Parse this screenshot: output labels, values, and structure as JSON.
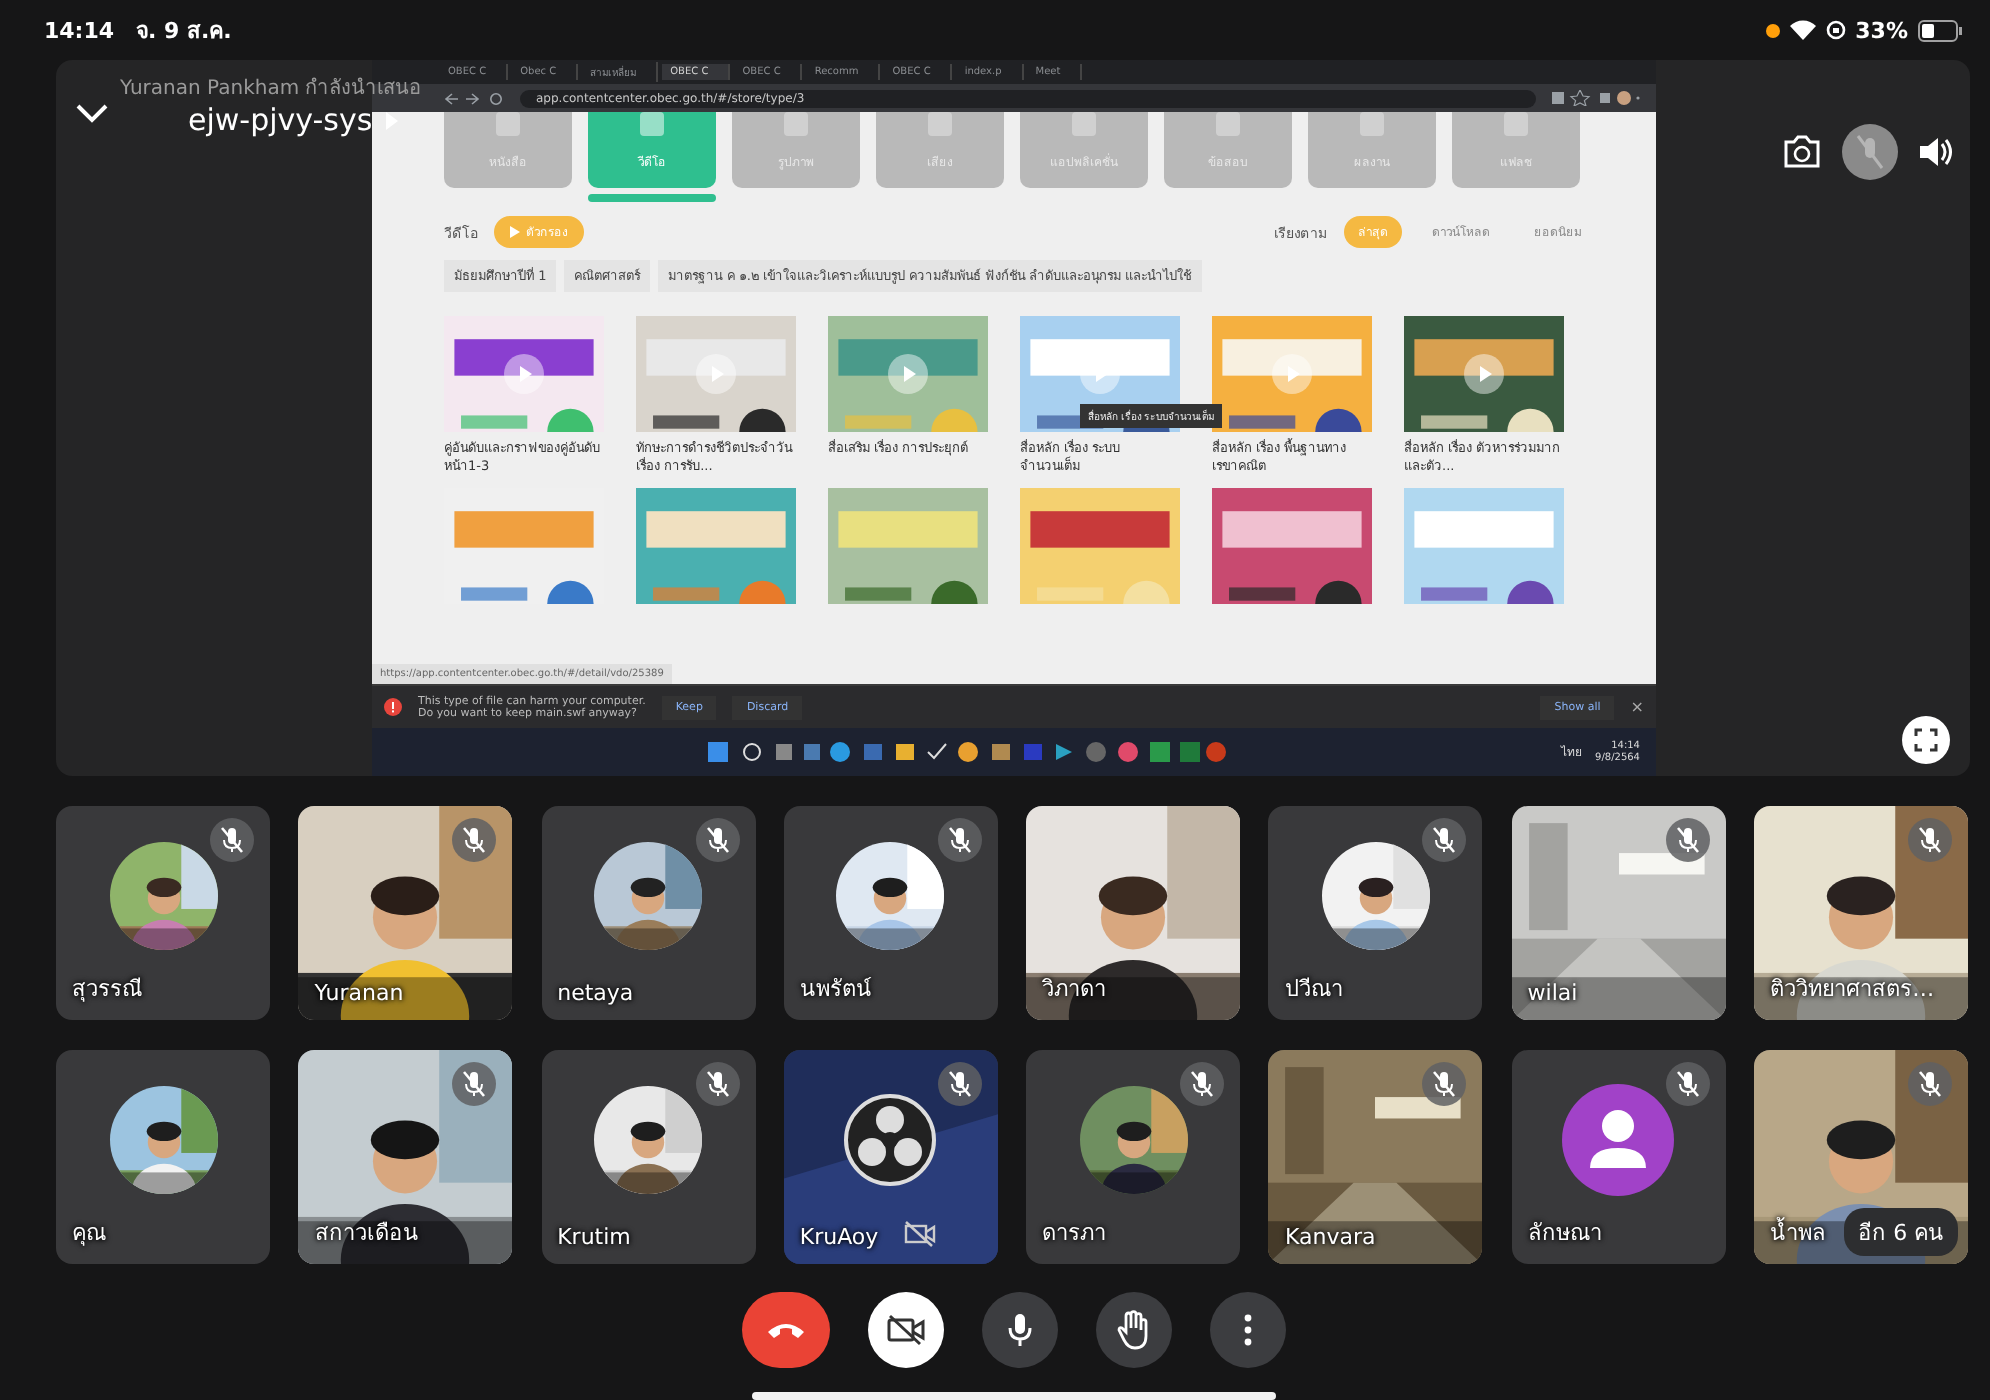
{
  "status_bar": {
    "time": "14:14",
    "date": "จ. 9 ส.ค.",
    "battery": "33%"
  },
  "presentation": {
    "presenter": "Yuranan Pankham กำลังนำเสนอ",
    "meeting_code": "ejw-pjvy-sys"
  },
  "shared_screen": {
    "browser_tabs": [
      {
        "title": "OBEC C",
        "selected": false
      },
      {
        "title": "Obec C",
        "selected": false
      },
      {
        "title": "สามเหลี่ยม",
        "selected": false
      },
      {
        "title": "OBEC C",
        "selected": true
      },
      {
        "title": "OBEC C",
        "selected": false
      },
      {
        "title": "Recomm",
        "selected": false
      },
      {
        "title": "OBEC C",
        "selected": false
      },
      {
        "title": "index.p",
        "selected": false
      },
      {
        "title": "Meet",
        "selected": false
      }
    ],
    "url": "app.contentcenter.obec.go.th/#/store/type/3",
    "categories": [
      {
        "label": "หนังสือ",
        "selected": false
      },
      {
        "label": "วีดีโอ",
        "selected": true
      },
      {
        "label": "รูปภาพ",
        "selected": false
      },
      {
        "label": "เสียง",
        "selected": false
      },
      {
        "label": "แอปพลิเคชั่น",
        "selected": false
      },
      {
        "label": "ข้อสอบ",
        "selected": false
      },
      {
        "label": "ผลงาน",
        "selected": false
      },
      {
        "label": "แฟลช",
        "selected": false
      }
    ],
    "section_title": "วีดีโอ",
    "filter_button": "ตัวกรอง",
    "sort_label": "เรียงตาม",
    "sort_options": [
      {
        "label": "ล่าสุด",
        "selected": true
      },
      {
        "label": "ดาวน์โหลด",
        "selected": false
      },
      {
        "label": "ยอดนิยม",
        "selected": false
      }
    ],
    "breadcrumb": [
      "มัธยมศึกษาปีที่ 1",
      "คณิตศาสตร์",
      "มาตรฐาน ค ๑.๒ เข้าใจและวิเคราะห์แบบรูป ความสัมพันธ์ ฟังก์ชัน ลำดับและอนุกรม และนำไปใช้"
    ],
    "videos": [
      {
        "title": "คู่อันดับและกราฟของคู่อันดับ หน้า1-3"
      },
      {
        "title": "ทักษะการดำรงชีวิตประจำวัน เรื่อง การรับ..."
      },
      {
        "title": "สื่อเสริม เรื่อง การประยุกต์"
      },
      {
        "title": "สื่อหลัก เรื่อง ระบบจำนวนเต็ม",
        "tooltip": "สื่อหลัก เรื่อง ระบบจำนวนเต็ม"
      },
      {
        "title": "สื่อหลัก เรื่อง พื้นฐานทางเรขาคณิต"
      },
      {
        "title": "สื่อหลัก เรื่อง ตัวหารร่วมมากและตัว..."
      }
    ],
    "status_url": "https://app.contentcenter.obec.go.th/#/detail/vdo/25389",
    "download_warning": {
      "lines": [
        "This type of file can harm your computer.",
        "Do you want to keep main.swf anyway?"
      ],
      "keep": "Keep",
      "discard": "Discard",
      "show_all": "Show all",
      "close": "×"
    },
    "taskbar": {
      "language": "ไทย",
      "time": "14:14",
      "date": "9/8/2564"
    }
  },
  "participants": [
    {
      "name": "สุวรรณี",
      "kind": "avatar",
      "muted": true
    },
    {
      "name": "Yuranan",
      "kind": "video",
      "muted": true
    },
    {
      "name": "netaya",
      "kind": "avatar",
      "muted": true
    },
    {
      "name": "นพรัตน์",
      "kind": "avatar",
      "muted": true
    },
    {
      "name": "วิภาดา",
      "kind": "video",
      "muted": false
    },
    {
      "name": "ปวีณา",
      "kind": "avatar",
      "muted": true
    },
    {
      "name": "wilai",
      "kind": "video",
      "muted": true
    },
    {
      "name": "ติววิทยาศาสตร…",
      "kind": "video",
      "muted": true
    },
    {
      "name": "คุณ",
      "kind": "avatar",
      "muted": false
    },
    {
      "name": "สกาวเดือน",
      "kind": "video",
      "muted": true
    },
    {
      "name": "Krutim",
      "kind": "avatar",
      "muted": true
    },
    {
      "name": "KruAoy",
      "kind": "logo",
      "muted": true
    },
    {
      "name": "ดารภา",
      "kind": "avatar",
      "muted": true
    },
    {
      "name": "Kanvara",
      "kind": "video",
      "muted": true
    },
    {
      "name": "ลักษณา",
      "kind": "default",
      "muted": true
    },
    {
      "name": "น้ำพล",
      "kind": "video",
      "muted": true,
      "badge": "อีก 6 คน"
    }
  ],
  "controls": [
    {
      "kind": "end_call"
    },
    {
      "kind": "camera_off"
    },
    {
      "kind": "mic"
    },
    {
      "kind": "raise_hand"
    },
    {
      "kind": "more"
    }
  ]
}
